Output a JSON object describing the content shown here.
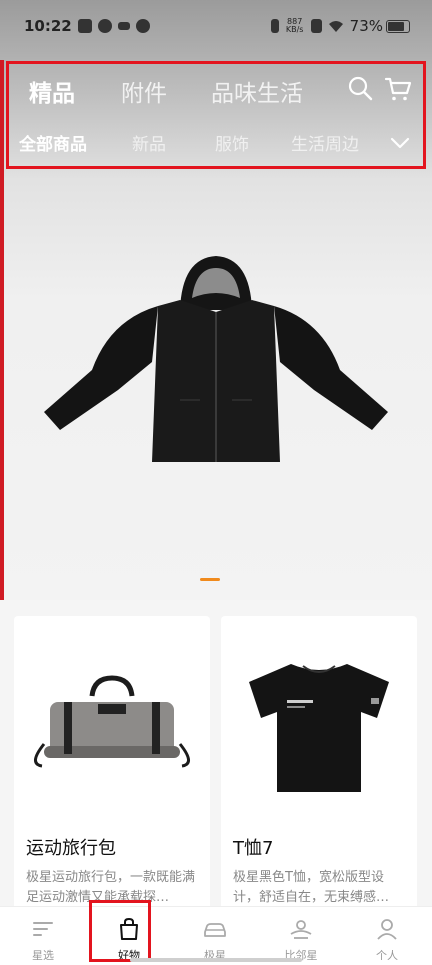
{
  "status_bar": {
    "time": "10:22",
    "net_speed_top": "887",
    "net_speed_bottom": "KB/s",
    "battery": "73%"
  },
  "top_nav": {
    "categories": [
      "精品",
      "附件",
      "品味生活"
    ],
    "active_category": 0,
    "subcategories": [
      "全部商品",
      "新品",
      "服饰",
      "生活周边"
    ],
    "active_subcategory": 0
  },
  "products": [
    {
      "title": "运动旅行包",
      "description": "极星运动旅行包，一款既能满足运动激情又能承载探…"
    },
    {
      "title": "T恤7",
      "description": "极星黑色T恤，宽松版型设计，舒适自在，无束缚感…"
    }
  ],
  "tabbar": {
    "items": [
      "星选",
      "好物",
      "极星",
      "比邻星",
      "个人"
    ],
    "active": 1
  },
  "colors": {
    "highlight_red": "#e3141e",
    "pager_orange": "#f08a1c"
  }
}
